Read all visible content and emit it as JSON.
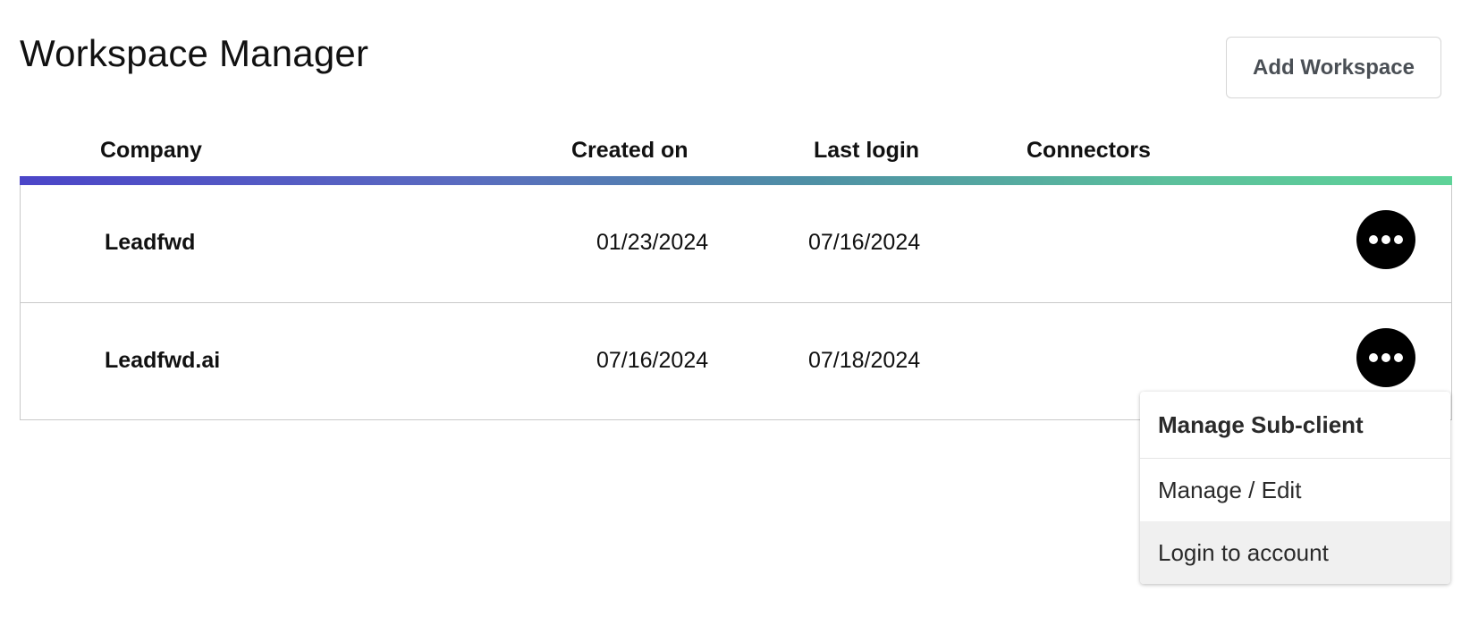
{
  "page": {
    "title": "Workspace Manager"
  },
  "toolbar": {
    "add_label": "Add Workspace"
  },
  "table": {
    "columns": {
      "company": "Company",
      "created_on": "Created on",
      "last_login": "Last login",
      "connectors": "Connectors"
    },
    "rows": [
      {
        "company": "Leadfwd",
        "created_on": "01/23/2024",
        "last_login": "07/16/2024",
        "connectors": ""
      },
      {
        "company": "Leadfwd.ai",
        "created_on": "07/16/2024",
        "last_login": "07/18/2024",
        "connectors": ""
      }
    ],
    "row_action_icon": "more-horizontal-icon"
  },
  "menu": {
    "header": "Manage Sub-client",
    "items": [
      {
        "label": "Manage / Edit"
      },
      {
        "label": "Login to account"
      }
    ],
    "highlighted_item": "Login to account"
  },
  "colors": {
    "gradient_start": "#4b45c8",
    "gradient_end": "#5ed398",
    "action_button": "#000000",
    "button_text": "#4a4f55",
    "border": "#c9c9c9",
    "menu_hover": "#f0f0f0"
  }
}
